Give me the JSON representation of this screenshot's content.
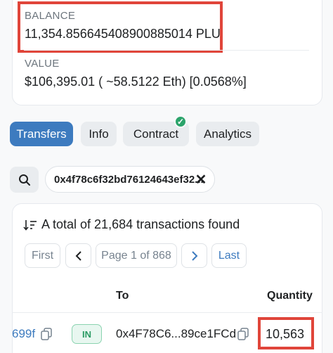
{
  "overview": {
    "balance_label": "BALANCE",
    "balance_value": "11,354.856645408900885014 PLU",
    "value_label": "VALUE",
    "value_value": "$106,395.01 ( ~58.5122 Eth) [0.0568%]"
  },
  "tabs": [
    {
      "label": "Transfers",
      "active": true
    },
    {
      "label": "Info",
      "active": false
    },
    {
      "label": "Contract",
      "active": false,
      "verified": true
    },
    {
      "label": "Analytics",
      "active": false
    }
  ],
  "filter": {
    "address": "0x4f78c6f32bd76124643ef32..."
  },
  "transactions": {
    "summary": "A total of 21,684 transactions found",
    "pagination": {
      "first": "First",
      "page_info": "Page 1 of 868",
      "last": "Last"
    },
    "columns": {
      "to": "To",
      "quantity": "Quantity"
    },
    "rows": [
      {
        "tx_fragment": "699f",
        "direction": "IN",
        "to": "0x4F78C6...89ce1FCd",
        "quantity": "10,563"
      }
    ]
  },
  "colors": {
    "accent": "#3d7bbf",
    "highlight": "#e0453a",
    "in_badge": "#2a9b64",
    "verified": "#2ca46b"
  },
  "icons": [
    "search-icon",
    "close-icon",
    "sort-icon",
    "chevron-left-icon",
    "chevron-right-icon",
    "copy-icon",
    "check-icon"
  ]
}
